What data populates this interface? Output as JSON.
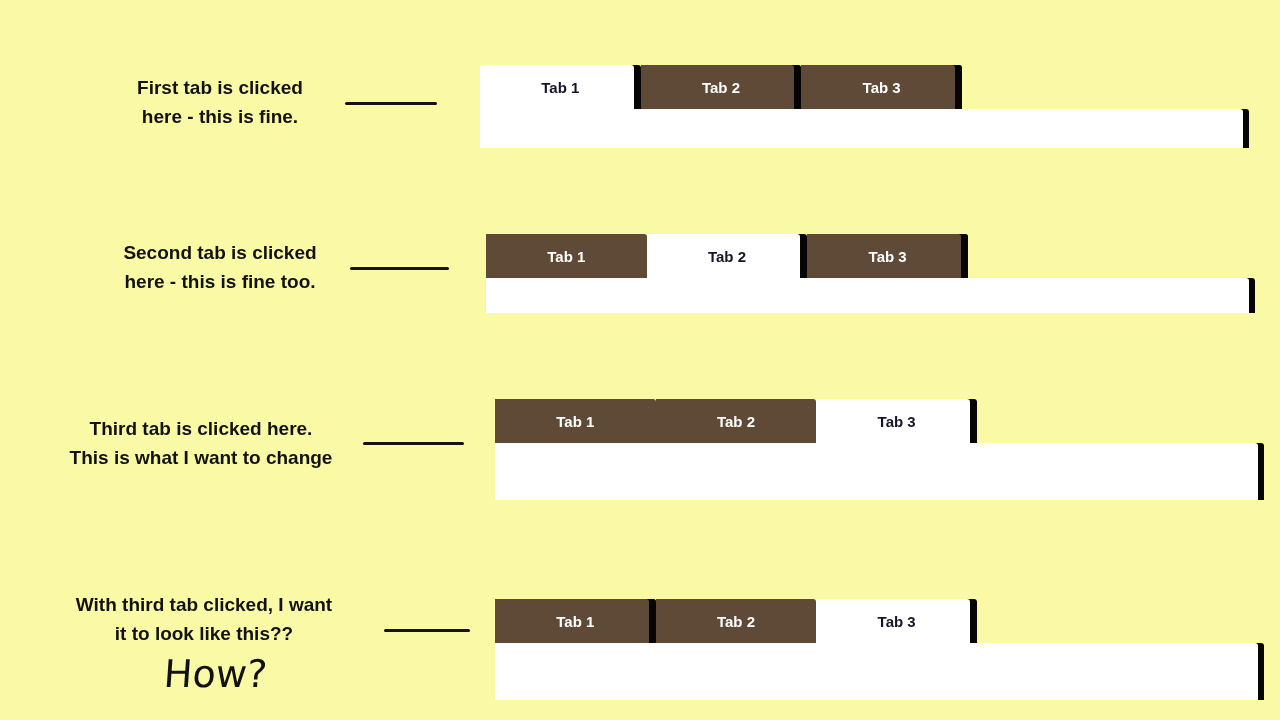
{
  "examples": [
    {
      "caption": "First tab is clicked\nhere - this is fine.",
      "tabs": [
        {
          "label": "Tab 1",
          "selected": true,
          "dark_edge": true
        },
        {
          "label": "Tab 2",
          "selected": false,
          "dark_edge": true
        },
        {
          "label": "Tab 3",
          "selected": false,
          "dark_edge": true
        }
      ]
    },
    {
      "caption": "Second tab is clicked\nhere - this is fine too.",
      "tabs": [
        {
          "label": "Tab 1",
          "selected": false,
          "dark_edge": false
        },
        {
          "label": "Tab 2",
          "selected": true,
          "dark_edge": true
        },
        {
          "label": "Tab 3",
          "selected": false,
          "dark_edge": true
        }
      ]
    },
    {
      "caption": "Third tab is clicked here.\nThis is what I want to change",
      "tabs": [
        {
          "label": "Tab 1",
          "selected": false,
          "dark_edge": false
        },
        {
          "label": "Tab 2",
          "selected": false,
          "dark_edge": false
        },
        {
          "label": "Tab 3",
          "selected": true,
          "dark_edge": true
        }
      ]
    },
    {
      "caption": "With third tab clicked, I want\nit to look like this??",
      "note": "How?",
      "tabs": [
        {
          "label": "Tab 1",
          "selected": false,
          "dark_edge": true
        },
        {
          "label": "Tab 2",
          "selected": false,
          "dark_edge": false
        },
        {
          "label": "Tab 3",
          "selected": true,
          "dark_edge": true
        }
      ]
    }
  ]
}
